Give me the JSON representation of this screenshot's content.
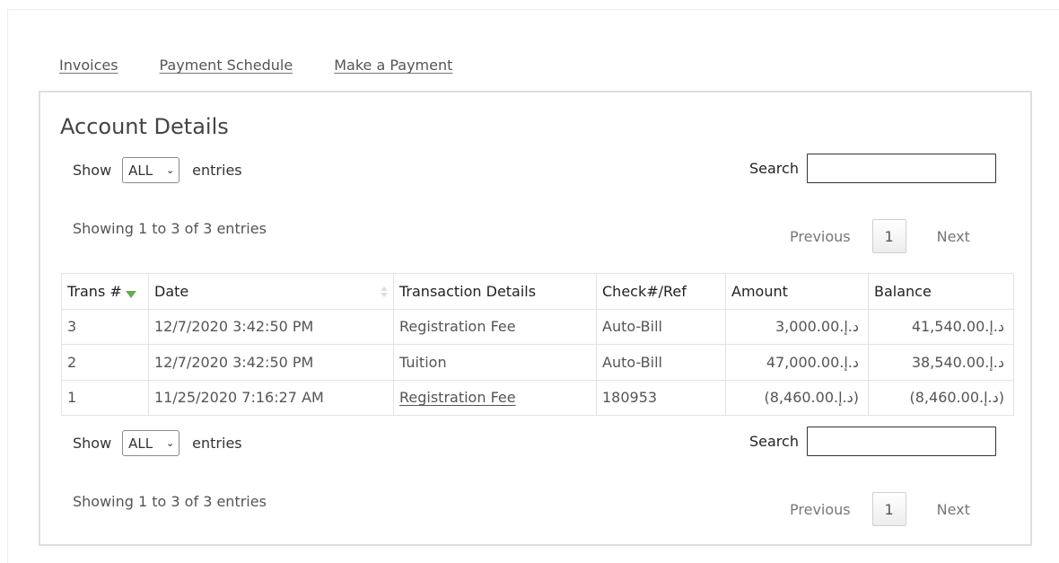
{
  "nav": {
    "links": [
      "Invoices",
      "Payment Schedule",
      "Make a Payment"
    ]
  },
  "panel": {
    "title": "Account Details"
  },
  "controls": {
    "show_label": "Show",
    "length_value": "ALL",
    "entries_label": "entries",
    "search_label": "Search",
    "search_value": ""
  },
  "info_text": "Showing 1 to 3 of 3 entries",
  "pager": {
    "previous": "Previous",
    "current_page": "1",
    "next": "Next"
  },
  "table": {
    "columns": [
      "Trans #",
      "Date",
      "Transaction Details",
      "Check#/Ref",
      "Amount",
      "Balance"
    ],
    "rows": [
      {
        "trans": "3",
        "date": "12/7/2020 3:42:50 PM",
        "details": "Registration Fee",
        "ref": "Auto-Bill",
        "amount": "د.إ.3,000.00",
        "balance": "د.إ.41,540.00"
      },
      {
        "trans": "2",
        "date": "12/7/2020 3:42:50 PM",
        "details": "Tuition",
        "ref": "Auto-Bill",
        "amount": "د.إ.47,000.00",
        "balance": "د.إ.38,540.00"
      },
      {
        "trans": "1",
        "date": "11/25/2020 7:16:27 AM",
        "details": "Registration Fee",
        "ref": "180953",
        "amount": "(د.إ.8,460.00)",
        "balance": "(د.إ.8,460.00)"
      }
    ]
  }
}
